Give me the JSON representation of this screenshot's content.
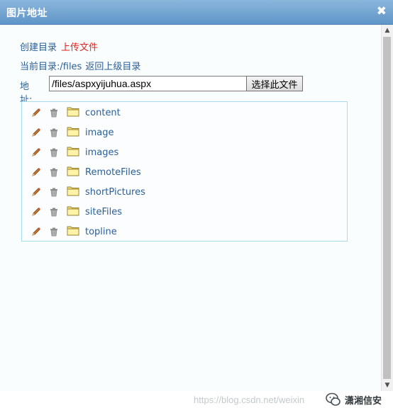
{
  "dialog": {
    "title": "图片地址",
    "close_glyph": "✖"
  },
  "actions": {
    "create_dir": "创建目录",
    "upload_file": "上传文件"
  },
  "nav": {
    "current_dir_label": "当前目录:/files",
    "back_parent": "返回上级目录"
  },
  "address": {
    "label": "地址:",
    "value": "/files/aspxyijuhua.aspx",
    "select_button": "选择此文件"
  },
  "files": [
    {
      "name": "content",
      "icon": "folder-icon"
    },
    {
      "name": "image",
      "icon": "folder-icon"
    },
    {
      "name": "images",
      "icon": "folder-icon"
    },
    {
      "name": "RemoteFiles",
      "icon": "folder-icon"
    },
    {
      "name": "shortPictures",
      "icon": "folder-icon"
    },
    {
      "name": "siteFiles",
      "icon": "folder-icon"
    },
    {
      "name": "topline",
      "icon": "folder-icon"
    }
  ],
  "watermark": {
    "url": "https://blog.csdn.net/weixin",
    "brand": "潇湘信安"
  },
  "colors": {
    "title_bar": "#6fa2d2",
    "link": "#2b5f97",
    "upload_link": "#e4211b",
    "list_border": "#a9dbef"
  }
}
